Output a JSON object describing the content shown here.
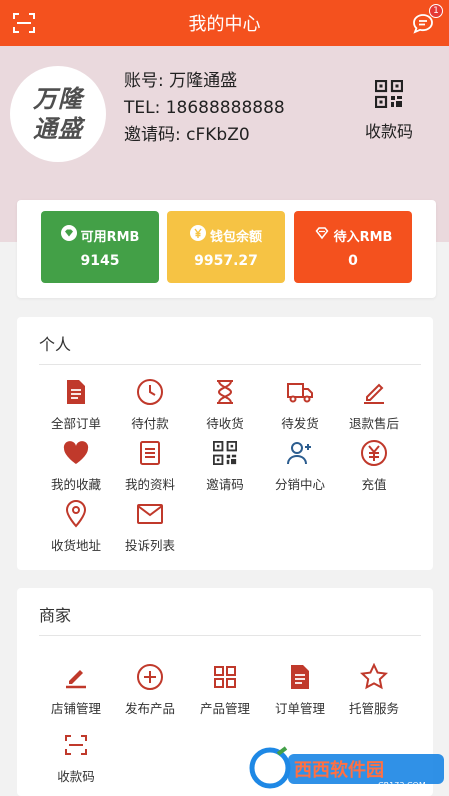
{
  "header": {
    "title": "我的中心",
    "notify_count": "1"
  },
  "profile": {
    "logo_line1": "万隆",
    "logo_line2": "通盛",
    "account": "账号: 万隆通盛",
    "tel": "TEL: 18688888888",
    "invite": "邀请码: cFKbZ0",
    "qr_label": "收款码"
  },
  "wallet": [
    {
      "label": "可用RMB",
      "value": "9145",
      "icon": "diamond-icon",
      "color": "#43a047"
    },
    {
      "label": "钱包余额",
      "value": "9957.27",
      "icon": "yen-coin-icon",
      "color": "#f6c344"
    },
    {
      "label": "待入RMB",
      "value": "0",
      "icon": "diamond-outline-icon",
      "color": "#f4511e"
    }
  ],
  "personal": {
    "title": "个人",
    "items": [
      {
        "label": "全部订单",
        "icon": "document-icon"
      },
      {
        "label": "待付款",
        "icon": "clock-icon"
      },
      {
        "label": "待收货",
        "icon": "hourglass-icon"
      },
      {
        "label": "待发货",
        "icon": "truck-icon"
      },
      {
        "label": "退款售后",
        "icon": "pencil-icon"
      },
      {
        "label": "我的收藏",
        "icon": "heart-icon"
      },
      {
        "label": "我的资料",
        "icon": "profile-doc-icon"
      },
      {
        "label": "邀请码",
        "icon": "qr-code-icon"
      },
      {
        "label": "分销中心",
        "icon": "user-add-icon"
      },
      {
        "label": "充值",
        "icon": "yen-circle-icon"
      },
      {
        "label": "收货地址",
        "icon": "location-icon"
      },
      {
        "label": "投诉列表",
        "icon": "mail-icon"
      }
    ]
  },
  "merchant": {
    "title": "商家",
    "items": [
      {
        "label": "店铺管理",
        "icon": "edit-icon"
      },
      {
        "label": "发布产品",
        "icon": "plus-circle-icon"
      },
      {
        "label": "产品管理",
        "icon": "grid-icon"
      },
      {
        "label": "订单管理",
        "icon": "document-icon"
      },
      {
        "label": "托管服务",
        "icon": "star-icon"
      },
      {
        "label": "收款码",
        "icon": "scan-icon"
      }
    ]
  },
  "colors": {
    "brand": "#f4511e",
    "icon": "#c0392b",
    "profile_bg": "#ead9dd"
  },
  "watermark": {
    "line1": "西西软件园",
    "line2": "CR173.COM"
  }
}
